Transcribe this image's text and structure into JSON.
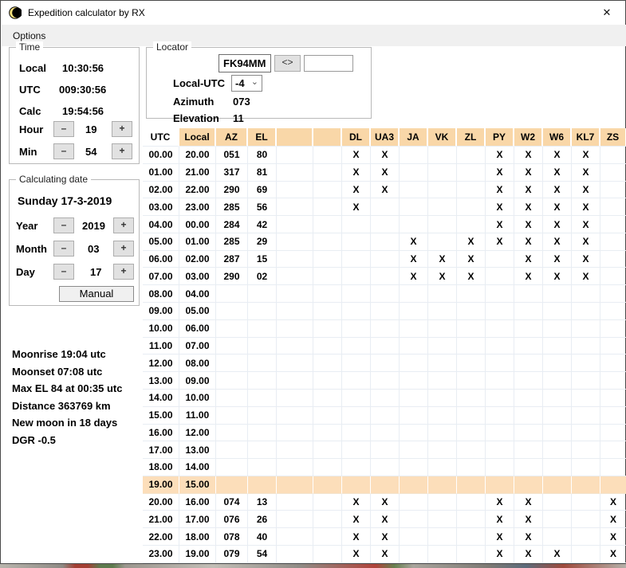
{
  "window": {
    "title": "Expedition calculator by RX"
  },
  "glyphs": {
    "close": "✕",
    "minus": "–",
    "plus": "+",
    "swap": "<>",
    "chevron_down": "⌄"
  },
  "menu": {
    "items": [
      {
        "label": "Options"
      }
    ]
  },
  "time_box": {
    "legend": "Time",
    "rows": [
      {
        "label": "Local",
        "value": "10:30:56"
      },
      {
        "label": "UTC",
        "value": "009:30:56"
      },
      {
        "label": "Calc",
        "value": "19:54:56"
      }
    ],
    "hour": {
      "label": "Hour",
      "value": "19"
    },
    "min": {
      "label": "Min",
      "value": "54"
    }
  },
  "locator_box": {
    "legend": "Locator",
    "locator_value": "FK94MM",
    "secondary_value": "",
    "local_utc": {
      "label": "Local-UTC",
      "value": "-4"
    },
    "azimuth": {
      "label": "Azimuth",
      "value": "073"
    },
    "elevation": {
      "label": "Elevation",
      "value": "11"
    }
  },
  "date_box": {
    "legend": "Calculating date",
    "date_text": "Sunday 17-3-2019",
    "year": {
      "label": "Year",
      "value": "2019"
    },
    "month": {
      "label": "Month",
      "value": "03"
    },
    "day": {
      "label": "Day",
      "value": "17"
    },
    "manual_button": "Manual"
  },
  "moon_info": {
    "lines": [
      "Moonrise 19:04 utc",
      "Moonset 07:08 utc",
      "Max EL 84 at 00:35 utc",
      "Distance 363769 km",
      "New moon in 18 days",
      "DGR -0.5"
    ]
  },
  "colors": {
    "header_bg": "#f9d7a8",
    "highlight_bg": "#fcdeba",
    "grid": "#e8edf3"
  },
  "table": {
    "columns": [
      "UTC",
      "Local",
      "AZ",
      "EL",
      "",
      "",
      "DL",
      "UA3",
      "JA",
      "VK",
      "ZL",
      "PY",
      "W2",
      "W6",
      "KL7",
      "ZS"
    ],
    "highlight_row_utc": "19.00",
    "rows": [
      {
        "utc": "00.00",
        "local": "20.00",
        "az": "051",
        "el": "80",
        "marks": [
          "X",
          "X",
          "",
          "",
          "",
          "X",
          "X",
          "X",
          "X",
          ""
        ]
      },
      {
        "utc": "01.00",
        "local": "21.00",
        "az": "317",
        "el": "81",
        "marks": [
          "X",
          "X",
          "",
          "",
          "",
          "X",
          "X",
          "X",
          "X",
          ""
        ]
      },
      {
        "utc": "02.00",
        "local": "22.00",
        "az": "290",
        "el": "69",
        "marks": [
          "X",
          "X",
          "",
          "",
          "",
          "X",
          "X",
          "X",
          "X",
          ""
        ]
      },
      {
        "utc": "03.00",
        "local": "23.00",
        "az": "285",
        "el": "56",
        "marks": [
          "X",
          "",
          "",
          "",
          "",
          "X",
          "X",
          "X",
          "X",
          ""
        ]
      },
      {
        "utc": "04.00",
        "local": "00.00",
        "az": "284",
        "el": "42",
        "marks": [
          "",
          "",
          "",
          "",
          "",
          "X",
          "X",
          "X",
          "X",
          ""
        ]
      },
      {
        "utc": "05.00",
        "local": "01.00",
        "az": "285",
        "el": "29",
        "marks": [
          "",
          "",
          "X",
          "",
          "X",
          "X",
          "X",
          "X",
          "X",
          ""
        ]
      },
      {
        "utc": "06.00",
        "local": "02.00",
        "az": "287",
        "el": "15",
        "marks": [
          "",
          "",
          "X",
          "X",
          "X",
          "",
          "X",
          "X",
          "X",
          ""
        ]
      },
      {
        "utc": "07.00",
        "local": "03.00",
        "az": "290",
        "el": "02",
        "marks": [
          "",
          "",
          "X",
          "X",
          "X",
          "",
          "X",
          "X",
          "X",
          ""
        ]
      },
      {
        "utc": "08.00",
        "local": "04.00",
        "az": "",
        "el": "",
        "marks": [
          "",
          "",
          "",
          "",
          "",
          "",
          "",
          "",
          "",
          ""
        ]
      },
      {
        "utc": "09.00",
        "local": "05.00",
        "az": "",
        "el": "",
        "marks": [
          "",
          "",
          "",
          "",
          "",
          "",
          "",
          "",
          "",
          ""
        ]
      },
      {
        "utc": "10.00",
        "local": "06.00",
        "az": "",
        "el": "",
        "marks": [
          "",
          "",
          "",
          "",
          "",
          "",
          "",
          "",
          "",
          ""
        ]
      },
      {
        "utc": "11.00",
        "local": "07.00",
        "az": "",
        "el": "",
        "marks": [
          "",
          "",
          "",
          "",
          "",
          "",
          "",
          "",
          "",
          ""
        ]
      },
      {
        "utc": "12.00",
        "local": "08.00",
        "az": "",
        "el": "",
        "marks": [
          "",
          "",
          "",
          "",
          "",
          "",
          "",
          "",
          "",
          ""
        ]
      },
      {
        "utc": "13.00",
        "local": "09.00",
        "az": "",
        "el": "",
        "marks": [
          "",
          "",
          "",
          "",
          "",
          "",
          "",
          "",
          "",
          ""
        ]
      },
      {
        "utc": "14.00",
        "local": "10.00",
        "az": "",
        "el": "",
        "marks": [
          "",
          "",
          "",
          "",
          "",
          "",
          "",
          "",
          "",
          ""
        ]
      },
      {
        "utc": "15.00",
        "local": "11.00",
        "az": "",
        "el": "",
        "marks": [
          "",
          "",
          "",
          "",
          "",
          "",
          "",
          "",
          "",
          ""
        ]
      },
      {
        "utc": "16.00",
        "local": "12.00",
        "az": "",
        "el": "",
        "marks": [
          "",
          "",
          "",
          "",
          "",
          "",
          "",
          "",
          "",
          ""
        ]
      },
      {
        "utc": "17.00",
        "local": "13.00",
        "az": "",
        "el": "",
        "marks": [
          "",
          "",
          "",
          "",
          "",
          "",
          "",
          "",
          "",
          ""
        ]
      },
      {
        "utc": "18.00",
        "local": "14.00",
        "az": "",
        "el": "",
        "marks": [
          "",
          "",
          "",
          "",
          "",
          "",
          "",
          "",
          "",
          ""
        ]
      },
      {
        "utc": "19.00",
        "local": "15.00",
        "az": "",
        "el": "",
        "marks": [
          "",
          "",
          "",
          "",
          "",
          "",
          "",
          "",
          "",
          ""
        ]
      },
      {
        "utc": "20.00",
        "local": "16.00",
        "az": "074",
        "el": "13",
        "marks": [
          "X",
          "X",
          "",
          "",
          "",
          "X",
          "X",
          "",
          "",
          "X"
        ]
      },
      {
        "utc": "21.00",
        "local": "17.00",
        "az": "076",
        "el": "26",
        "marks": [
          "X",
          "X",
          "",
          "",
          "",
          "X",
          "X",
          "",
          "",
          "X"
        ]
      },
      {
        "utc": "22.00",
        "local": "18.00",
        "az": "078",
        "el": "40",
        "marks": [
          "X",
          "X",
          "",
          "",
          "",
          "X",
          "X",
          "",
          "",
          "X"
        ]
      },
      {
        "utc": "23.00",
        "local": "19.00",
        "az": "079",
        "el": "54",
        "marks": [
          "X",
          "X",
          "",
          "",
          "",
          "X",
          "X",
          "X",
          "",
          "X"
        ]
      }
    ]
  }
}
